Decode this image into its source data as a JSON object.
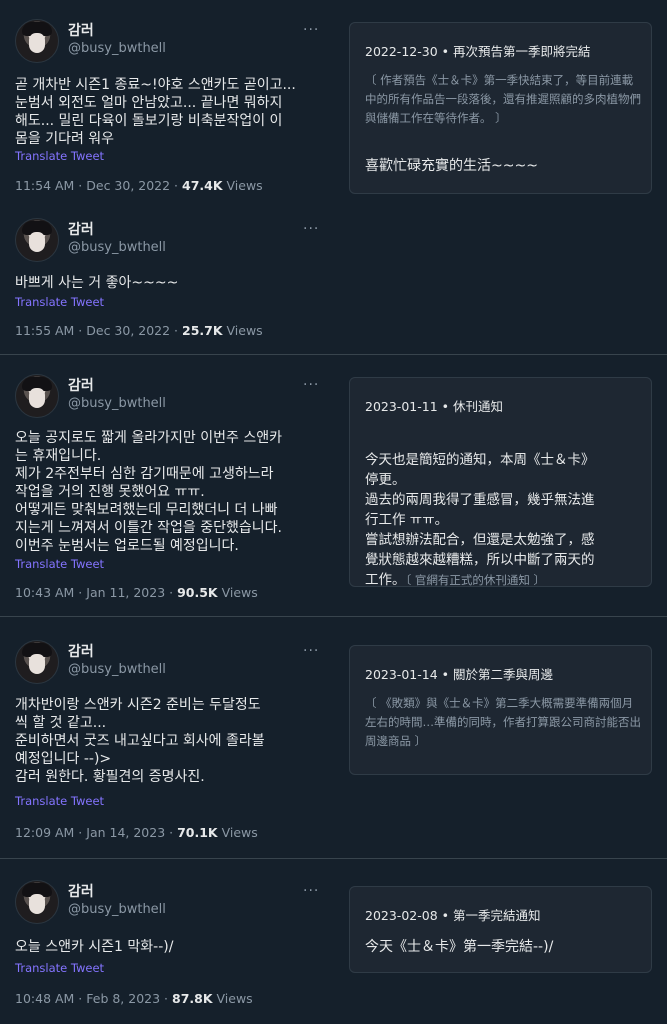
{
  "tweets": [
    {
      "name": "감러",
      "handle": "@busy_bwthell",
      "more": "···",
      "body": "곧 개차반 시즌1 종료~!야호 스앤카도 곧이고...\n눈범서 외전도 얼마 안남았고... 끝나면 뭐하지\n해도... 밀린 다육이 돌보기랑 비축분작업이 이\n몸을 기다려 워우",
      "translate": "Translate Tweet",
      "time": "11:54 AM · Dec 30, 2022 · ",
      "views": "47.4K",
      "views_label": " Views"
    },
    {
      "name": "감러",
      "handle": "@busy_bwthell",
      "more": "···",
      "body": "바쁘게 사는 거 좋아~~~~",
      "translate": "Translate Tweet",
      "time": "11:55 AM · Dec 30, 2022 · ",
      "views": "25.7K",
      "views_label": " Views"
    },
    {
      "name": "감러",
      "handle": "@busy_bwthell",
      "more": "···",
      "body": "오늘 공지로도 짧게 올라가지만 이번주 스앤카\n는 휴재입니다.\n제가 2주전부터 심한 감기때문에 고생하느라\n작업을 거의 진행 못했어요 ㅠㅠ.\n어떻게든 맞춰보려했는데 무리했더니 더 나빠\n지는게 느껴져서 이틀간 작업을 중단했습니다.\n이번주 눈범서는 업로드될 예정입니다.",
      "translate": "Translate Tweet",
      "time": "10:43 AM · Jan 11, 2023 · ",
      "views": "90.5K",
      "views_label": " Views"
    },
    {
      "name": "감러",
      "handle": "@busy_bwthell",
      "more": "···",
      "body": "개차반이랑 스앤카 시즌2 준비는 두달정도\n씩 할 것 같고...\n준비하면서 굿즈 내고싶다고 회사에 졸라볼\n예정입니다 --)>\n감러 원한다. 황필견의 증명사진.",
      "translate": "Translate Tweet",
      "time": "12:09 AM · Jan 14, 2023 · ",
      "views": "70.1K",
      "views_label": " Views"
    },
    {
      "name": "감러",
      "handle": "@busy_bwthell",
      "more": "···",
      "body": "오늘 스앤카 시즌1 막화--)/",
      "translate": "Translate Tweet",
      "time": "10:48 AM · Feb 8, 2023 · ",
      "views": "87.8K",
      "views_label": " Views"
    }
  ],
  "cards": [
    {
      "date": "2022-12-30",
      "title": "再次預告第一季即將完結",
      "note": "〔 作者預告《士＆卡》第一季快結束了，等目前連載中的所有作品告一段落後，還有推遲照顧的多肉植物們與儲備工作在等待作者。 〕",
      "body": "喜歡忙碌充實的生活~~~~"
    },
    {
      "date": "2023-01-11",
      "title": "休刊通知",
      "body": "今天也是簡短的通知，本周《士＆卡》\n停更。\n過去的兩周我得了重感冒，幾乎無法進\n行工作 ㅠㅠ。\n嘗試想辦法配合，但還是太勉強了，感\n覺狀態越來越糟糕，所以中斷了兩天的\n工作。",
      "body_note": "〔 官網有正式的休刊通知 〕"
    },
    {
      "date": "2023-01-14",
      "title": "關於第二季與周邊",
      "note": "〔 《敗類》與《士＆卡》第二季大概需要準備兩個月左右的時間…準備的同時，作者打算跟公司商討能否出周邊商品 〕"
    },
    {
      "date": "2023-02-08",
      "title": "第一季完結通知",
      "body": "今天《士＆卡》第一季完結--)/"
    }
  ],
  "separator": " • "
}
